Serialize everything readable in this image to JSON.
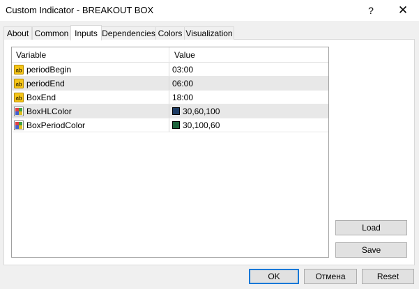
{
  "window": {
    "title": "Custom Indicator - BREAKOUT BOX",
    "help_label": "?",
    "close_label": "✕"
  },
  "tabs": [
    {
      "label": "About"
    },
    {
      "label": "Common"
    },
    {
      "label": "Inputs"
    },
    {
      "label": "Dependencies"
    },
    {
      "label": "Colors"
    },
    {
      "label": "Visualization"
    }
  ],
  "active_tab": "Inputs",
  "grid": {
    "columns": [
      "Variable",
      "Value"
    ],
    "rows": [
      {
        "type": "string",
        "variable": "periodBegin",
        "value": "03:00"
      },
      {
        "type": "string",
        "variable": "periodEnd",
        "value": "06:00"
      },
      {
        "type": "string",
        "variable": "BoxEnd",
        "value": "18:00"
      },
      {
        "type": "color",
        "variable": "BoxHLColor",
        "value": "30,60,100",
        "swatch": "#1e3c64"
      },
      {
        "type": "color",
        "variable": "BoxPeriodColor",
        "value": "30,100,60",
        "swatch": "#1e643c"
      }
    ]
  },
  "side_buttons": {
    "load_label": "Load",
    "save_label": "Save"
  },
  "footer": {
    "ok_label": "OK",
    "cancel_label": "Отмена",
    "reset_label": "Reset"
  },
  "colors": {
    "accent": "#0078d7",
    "string_icon": "#e8b400"
  }
}
